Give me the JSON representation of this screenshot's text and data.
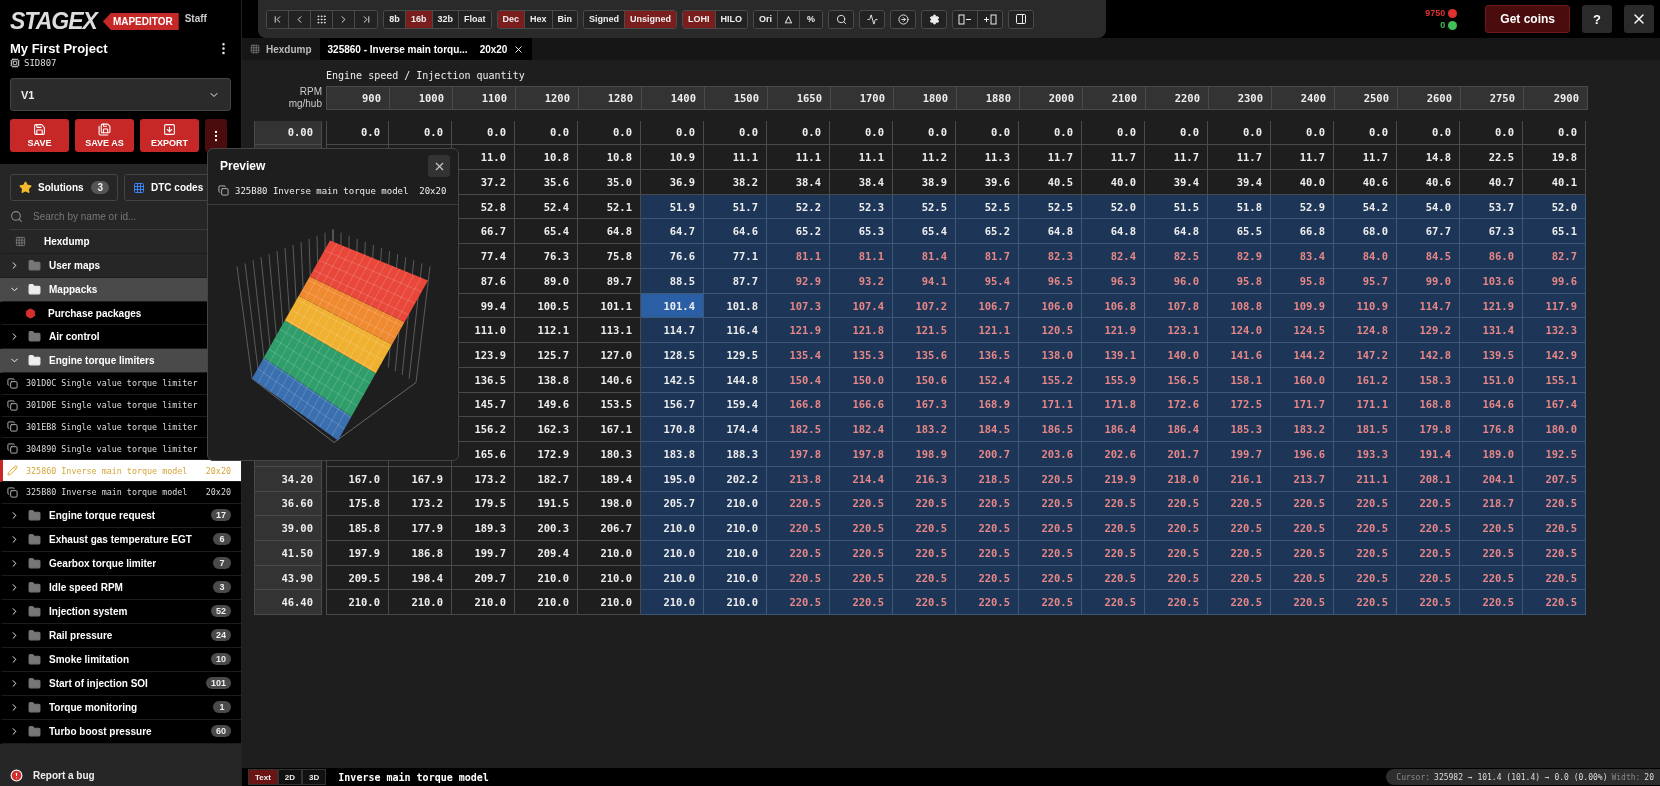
{
  "sidebar": {
    "logo": "STAGEX",
    "product": "MAPEDITOR",
    "role": "Staff",
    "project": {
      "title": "My First Project",
      "ecu": "SID807"
    },
    "version_select": {
      "value": "V1"
    },
    "actions": [
      {
        "kind": "save",
        "label": "SAVE"
      },
      {
        "kind": "save_as",
        "label": "SAVE AS"
      },
      {
        "kind": "export",
        "label": "EXPORT"
      }
    ],
    "solutions": {
      "label": "Solutions",
      "count": "3"
    },
    "dtc": {
      "label": "DTC codes"
    },
    "search": {
      "placeholder": "Search by name or id..."
    },
    "tree": [
      {
        "kind": "hexdump",
        "label": "Hexdump"
      },
      {
        "kind": "folder",
        "label": "User maps",
        "expanded": false
      },
      {
        "kind": "folder",
        "label": "Mappacks",
        "expanded": true,
        "children": [
          {
            "kind": "shop",
            "label": "Purchase packages"
          }
        ]
      },
      {
        "kind": "folder",
        "label": "Air control",
        "expanded": false
      },
      {
        "kind": "folder",
        "label": "Engine torque limiters",
        "expanded": true,
        "children": [
          {
            "kind": "map",
            "address": "301D0C",
            "label": "Single value torque limiter",
            "edited": false,
            "selected": false
          },
          {
            "kind": "map",
            "address": "301D0E",
            "label": "Single value torque limiter",
            "edited": false,
            "selected": false
          },
          {
            "kind": "map",
            "address": "301EB8",
            "label": "Single value torque limiter",
            "edited": false,
            "selected": false
          },
          {
            "kind": "map",
            "address": "304890",
            "label": "Single value torque limiter",
            "edited": false,
            "selected": false
          },
          {
            "kind": "map",
            "address": "325860",
            "label": "Inverse main torque model",
            "size": "20x20",
            "edited": true,
            "selected": true
          },
          {
            "kind": "map",
            "address": "325B80",
            "label": "Inverse main torque model",
            "size": "20x20",
            "edited": false,
            "selected": false
          }
        ]
      },
      {
        "kind": "folder",
        "label": "Engine torque request",
        "count": "17",
        "expanded": false
      },
      {
        "kind": "folder",
        "label": "Exhaust gas temperature EGT",
        "count": "6",
        "expanded": false
      },
      {
        "kind": "folder",
        "label": "Gearbox torque limiter",
        "count": "7",
        "expanded": false
      },
      {
        "kind": "folder",
        "label": "Idle speed RPM",
        "count": "3",
        "expanded": false
      },
      {
        "kind": "folder",
        "label": "Injection system",
        "count": "52",
        "expanded": false
      },
      {
        "kind": "folder",
        "label": "Rail pressure",
        "count": "24",
        "expanded": false
      },
      {
        "kind": "folder",
        "label": "Smoke limitation",
        "count": "10",
        "expanded": false
      },
      {
        "kind": "folder",
        "label": "Start of injection SOI",
        "count": "101",
        "expanded": false
      },
      {
        "kind": "folder",
        "label": "Torque monitoring",
        "count": "1",
        "expanded": false
      },
      {
        "kind": "folder",
        "label": "Turbo boost pressure",
        "count": "60",
        "expanded": false
      }
    ],
    "report": "Report a bug"
  },
  "toolbar": {
    "groups": [
      {
        "buttons": [
          {
            "label": "8b",
            "selected": false
          },
          {
            "label": "16b",
            "selected": true
          },
          {
            "label": "32b",
            "selected": false
          },
          {
            "label": "Float",
            "selected": false
          }
        ]
      },
      {
        "buttons": [
          {
            "label": "Dec",
            "selected": true
          },
          {
            "label": "Hex",
            "selected": false
          },
          {
            "label": "Bin",
            "selected": false
          }
        ]
      },
      {
        "buttons": [
          {
            "label": "Signed",
            "selected": false
          },
          {
            "label": "Unsigned",
            "selected": true
          }
        ]
      },
      {
        "buttons": [
          {
            "label": "LOHI",
            "selected": true
          },
          {
            "label": "HILO",
            "selected": false
          }
        ]
      },
      {
        "buttons": [
          {
            "label": "Ori",
            "selected": false
          },
          {
            "label": "△",
            "selected": false
          },
          {
            "label": "%",
            "selected": false
          }
        ]
      }
    ]
  },
  "account": {
    "coins": [
      {
        "value": "9750",
        "color": "#e03131"
      },
      {
        "value": "0",
        "color": "#40c057"
      }
    ],
    "get_coins": "Get coins",
    "help": "?"
  },
  "tabs": [
    {
      "kind": "hexdump",
      "label": "Hexdump",
      "selected": false
    },
    {
      "kind": "map",
      "label": "325860 - Inverse main torqu...",
      "size": "20x20",
      "selected": true
    }
  ],
  "table": {
    "title": "Engine speed / Injection quantity",
    "x_axis": "RPM",
    "y_axis": "mg/hub",
    "columns": [
      "900",
      "1000",
      "1100",
      "1200",
      "1280",
      "1400",
      "1500",
      "1650",
      "1700",
      "1800",
      "1880",
      "2000",
      "2100",
      "2200",
      "2300",
      "2400",
      "2500",
      "2600",
      "2750",
      "2900"
    ],
    "rows": [
      {
        "label": "0.00",
        "values": [
          "0.0",
          "0.0",
          "0.0",
          "0.0",
          "0.0",
          "0.0",
          "0.0",
          "0.0",
          "0.0",
          "0.0",
          "0.0",
          "0.0",
          "0.0",
          "0.0",
          "0.0",
          "0.0",
          "0.0",
          "0.0",
          "0.0",
          "0.0"
        ],
        "selected": [
          false,
          false,
          false,
          false,
          false,
          false,
          false,
          false,
          false,
          false,
          false,
          false,
          false,
          false,
          false,
          false,
          false,
          false,
          false,
          false
        ],
        "modified": [
          false,
          false,
          false,
          false,
          false,
          false,
          false,
          false,
          false,
          false,
          false,
          false,
          false,
          false,
          false,
          false,
          false,
          false,
          false,
          false
        ],
        "cursor": [
          false,
          false,
          false,
          false,
          false,
          false,
          false,
          false,
          false,
          false,
          false,
          false,
          false,
          false,
          false,
          false,
          false,
          false,
          false,
          false
        ]
      },
      {
        "values": [
          "11.0",
          "10.8",
          "10.8",
          "10.9",
          "11.1",
          "11.1",
          "11.1",
          "11.2",
          "11.3",
          "11.7",
          "11.7",
          "11.7",
          "11.7",
          "11.7",
          "11.7",
          "14.8",
          "22.5",
          "19.8"
        ],
        "selected": [
          false,
          false,
          false,
          false,
          false,
          false,
          false,
          false,
          false,
          false,
          false,
          false,
          false,
          false,
          false,
          false,
          false,
          false
        ],
        "modified": [
          false,
          false,
          false,
          false,
          false,
          false,
          false,
          false,
          false,
          false,
          false,
          false,
          false,
          false,
          false,
          false,
          false,
          false
        ],
        "cursor": [
          false,
          false,
          false,
          false,
          false,
          false,
          false,
          false,
          false,
          false,
          false,
          false,
          false,
          false,
          false,
          false,
          false,
          false
        ]
      },
      {
        "values": [
          "37.2",
          "35.6",
          "35.0",
          "36.9",
          "38.2",
          "38.4",
          "38.4",
          "38.9",
          "39.6",
          "40.5",
          "40.0",
          "39.4",
          "39.4",
          "40.0",
          "40.6",
          "40.6",
          "40.7",
          "40.1"
        ],
        "selected": [
          false,
          false,
          false,
          false,
          false,
          false,
          false,
          false,
          false,
          false,
          false,
          false,
          false,
          false,
          false,
          false,
          false,
          false
        ],
        "modified": [
          false,
          false,
          false,
          false,
          false,
          false,
          false,
          false,
          false,
          false,
          false,
          false,
          false,
          false,
          false,
          false,
          false,
          false
        ],
        "cursor": [
          false,
          false,
          false,
          false,
          false,
          false,
          false,
          false,
          false,
          false,
          false,
          false,
          false,
          false,
          false,
          false,
          false,
          false
        ]
      },
      {
        "values": [
          "52.8",
          "52.4",
          "52.1",
          "51.9",
          "51.7",
          "52.2",
          "52.3",
          "52.5",
          "52.5",
          "52.5",
          "52.0",
          "51.5",
          "51.8",
          "52.9",
          "54.2",
          "54.0",
          "53.7",
          "52.0"
        ],
        "selected": [
          false,
          false,
          false,
          true,
          true,
          true,
          true,
          true,
          true,
          true,
          true,
          true,
          true,
          true,
          true,
          true,
          true,
          true
        ],
        "modified": [
          false,
          false,
          false,
          false,
          false,
          false,
          false,
          false,
          false,
          false,
          false,
          false,
          false,
          false,
          false,
          false,
          false,
          false
        ],
        "cursor": [
          false,
          false,
          false,
          false,
          false,
          false,
          false,
          false,
          false,
          false,
          false,
          false,
          false,
          false,
          false,
          false,
          false,
          false
        ]
      },
      {
        "values": [
          "66.7",
          "65.4",
          "64.8",
          "64.7",
          "64.6",
          "65.2",
          "65.3",
          "65.4",
          "65.2",
          "64.8",
          "64.8",
          "64.8",
          "65.5",
          "66.8",
          "68.0",
          "67.7",
          "67.3",
          "65.1"
        ],
        "selected": [
          false,
          false,
          false,
          true,
          true,
          true,
          true,
          true,
          true,
          true,
          true,
          true,
          true,
          true,
          true,
          true,
          true,
          true
        ],
        "modified": [
          false,
          false,
          false,
          false,
          false,
          false,
          false,
          false,
          false,
          false,
          false,
          false,
          false,
          false,
          false,
          false,
          false,
          false
        ],
        "cursor": [
          false,
          false,
          false,
          false,
          false,
          false,
          false,
          false,
          false,
          false,
          false,
          false,
          false,
          false,
          false,
          false,
          false,
          false
        ]
      },
      {
        "values": [
          "77.4",
          "76.3",
          "75.8",
          "76.6",
          "77.1",
          "81.1",
          "81.1",
          "81.4",
          "81.7",
          "82.3",
          "82.4",
          "82.5",
          "82.9",
          "83.4",
          "84.0",
          "84.5",
          "86.0",
          "82.7"
        ],
        "selected": [
          false,
          false,
          false,
          true,
          true,
          true,
          true,
          true,
          true,
          true,
          true,
          true,
          true,
          true,
          true,
          true,
          true,
          true
        ],
        "modified": [
          false,
          false,
          false,
          false,
          false,
          true,
          true,
          true,
          true,
          true,
          true,
          true,
          true,
          true,
          true,
          true,
          true,
          true
        ],
        "cursor": [
          false,
          false,
          false,
          false,
          false,
          false,
          false,
          false,
          false,
          false,
          false,
          false,
          false,
          false,
          false,
          false,
          false,
          false
        ]
      },
      {
        "values": [
          "87.6",
          "89.0",
          "89.7",
          "88.5",
          "87.7",
          "92.9",
          "93.2",
          "94.1",
          "95.4",
          "96.5",
          "96.3",
          "96.0",
          "95.8",
          "95.8",
          "95.7",
          "99.0",
          "103.6",
          "99.6"
        ],
        "selected": [
          false,
          false,
          false,
          true,
          true,
          true,
          true,
          true,
          true,
          true,
          true,
          true,
          true,
          true,
          true,
          true,
          true,
          true
        ],
        "modified": [
          false,
          false,
          false,
          false,
          false,
          true,
          true,
          true,
          true,
          true,
          true,
          true,
          true,
          true,
          true,
          true,
          true,
          true
        ],
        "cursor": [
          false,
          false,
          false,
          false,
          false,
          false,
          false,
          false,
          false,
          false,
          false,
          false,
          false,
          false,
          false,
          false,
          false,
          false
        ]
      },
      {
        "values": [
          "99.4",
          "100.5",
          "101.1",
          "101.4",
          "101.8",
          "107.3",
          "107.4",
          "107.2",
          "106.7",
          "106.0",
          "106.8",
          "107.8",
          "108.8",
          "109.9",
          "110.9",
          "114.7",
          "121.9",
          "117.9"
        ],
        "selected": [
          false,
          false,
          false,
          true,
          true,
          true,
          true,
          true,
          true,
          true,
          true,
          true,
          true,
          true,
          true,
          true,
          true,
          true
        ],
        "modified": [
          false,
          false,
          false,
          false,
          false,
          true,
          true,
          true,
          true,
          true,
          true,
          true,
          true,
          true,
          true,
          true,
          true,
          true
        ],
        "cursor": [
          false,
          false,
          false,
          true,
          false,
          false,
          false,
          false,
          false,
          false,
          false,
          false,
          false,
          false,
          false,
          false,
          false,
          false
        ]
      },
      {
        "values": [
          "111.0",
          "112.1",
          "113.1",
          "114.7",
          "116.4",
          "121.9",
          "121.8",
          "121.5",
          "121.1",
          "120.5",
          "121.9",
          "123.1",
          "124.0",
          "124.5",
          "124.8",
          "129.2",
          "131.4",
          "132.3"
        ],
        "selected": [
          false,
          false,
          false,
          true,
          true,
          true,
          true,
          true,
          true,
          true,
          true,
          true,
          true,
          true,
          true,
          true,
          true,
          true
        ],
        "modified": [
          false,
          false,
          false,
          false,
          false,
          true,
          true,
          true,
          true,
          true,
          true,
          true,
          true,
          true,
          true,
          true,
          true,
          true
        ],
        "cursor": [
          false,
          false,
          false,
          false,
          false,
          false,
          false,
          false,
          false,
          false,
          false,
          false,
          false,
          false,
          false,
          false,
          false,
          false
        ]
      },
      {
        "values": [
          "123.9",
          "125.7",
          "127.0",
          "128.5",
          "129.5",
          "135.4",
          "135.3",
          "135.6",
          "136.5",
          "138.0",
          "139.1",
          "140.0",
          "141.6",
          "144.2",
          "147.2",
          "142.8",
          "139.5",
          "142.9"
        ],
        "selected": [
          false,
          false,
          false,
          true,
          true,
          true,
          true,
          true,
          true,
          true,
          true,
          true,
          true,
          true,
          true,
          true,
          true,
          true
        ],
        "modified": [
          false,
          false,
          false,
          false,
          false,
          true,
          true,
          true,
          true,
          true,
          true,
          true,
          true,
          true,
          true,
          true,
          true,
          true
        ],
        "cursor": [
          false,
          false,
          false,
          false,
          false,
          false,
          false,
          false,
          false,
          false,
          false,
          false,
          false,
          false,
          false,
          false,
          false,
          false
        ]
      },
      {
        "values": [
          "136.5",
          "138.8",
          "140.6",
          "142.5",
          "144.8",
          "150.4",
          "150.0",
          "150.6",
          "152.4",
          "155.2",
          "155.9",
          "156.5",
          "158.1",
          "160.0",
          "161.2",
          "158.3",
          "151.0",
          "155.1"
        ],
        "selected": [
          false,
          false,
          false,
          true,
          true,
          true,
          true,
          true,
          true,
          true,
          true,
          true,
          true,
          true,
          true,
          true,
          true,
          true
        ],
        "modified": [
          false,
          false,
          false,
          false,
          false,
          true,
          true,
          true,
          true,
          true,
          true,
          true,
          true,
          true,
          true,
          true,
          true,
          true
        ],
        "cursor": [
          false,
          false,
          false,
          false,
          false,
          false,
          false,
          false,
          false,
          false,
          false,
          false,
          false,
          false,
          false,
          false,
          false,
          false
        ]
      },
      {
        "values": [
          "145.7",
          "149.6",
          "153.5",
          "156.7",
          "159.4",
          "166.8",
          "166.6",
          "167.3",
          "168.9",
          "171.1",
          "171.8",
          "172.6",
          "172.5",
          "171.7",
          "171.1",
          "168.8",
          "164.6",
          "167.4"
        ],
        "selected": [
          false,
          false,
          false,
          true,
          true,
          true,
          true,
          true,
          true,
          true,
          true,
          true,
          true,
          true,
          true,
          true,
          true,
          true
        ],
        "modified": [
          false,
          false,
          false,
          false,
          false,
          true,
          true,
          true,
          true,
          true,
          true,
          true,
          true,
          true,
          true,
          true,
          true,
          true
        ],
        "cursor": [
          false,
          false,
          false,
          false,
          false,
          false,
          false,
          false,
          false,
          false,
          false,
          false,
          false,
          false,
          false,
          false,
          false,
          false
        ]
      },
      {
        "values": [
          "156.2",
          "162.3",
          "167.1",
          "170.8",
          "174.4",
          "182.5",
          "182.4",
          "183.2",
          "184.5",
          "186.5",
          "186.4",
          "186.4",
          "185.3",
          "183.2",
          "181.5",
          "179.8",
          "176.8",
          "180.0"
        ],
        "selected": [
          false,
          false,
          false,
          true,
          true,
          true,
          true,
          true,
          true,
          true,
          true,
          true,
          true,
          true,
          true,
          true,
          true,
          true
        ],
        "modified": [
          false,
          false,
          false,
          false,
          false,
          true,
          true,
          true,
          true,
          true,
          true,
          true,
          true,
          true,
          true,
          true,
          true,
          true
        ],
        "cursor": [
          false,
          false,
          false,
          false,
          false,
          false,
          false,
          false,
          false,
          false,
          false,
          false,
          false,
          false,
          false,
          false,
          false,
          false
        ]
      },
      {
        "values": [
          "165.6",
          "172.9",
          "180.3",
          "183.8",
          "188.3",
          "197.8",
          "197.8",
          "198.9",
          "200.7",
          "203.6",
          "202.6",
          "201.7",
          "199.7",
          "196.6",
          "193.3",
          "191.4",
          "189.0",
          "192.5"
        ],
        "selected": [
          false,
          false,
          false,
          true,
          true,
          true,
          true,
          true,
          true,
          true,
          true,
          true,
          true,
          true,
          true,
          true,
          true,
          true
        ],
        "modified": [
          false,
          false,
          false,
          false,
          false,
          true,
          true,
          true,
          true,
          true,
          true,
          true,
          true,
          true,
          true,
          true,
          true,
          true
        ],
        "cursor": [
          false,
          false,
          false,
          false,
          false,
          false,
          false,
          false,
          false,
          false,
          false,
          false,
          false,
          false,
          false,
          false,
          false,
          false
        ]
      },
      {
        "label": "34.20",
        "values": [
          "167.0",
          "167.9",
          "173.2",
          "182.7",
          "189.4",
          "195.0",
          "202.2",
          "213.8",
          "214.4",
          "216.3",
          "218.5",
          "220.5",
          "219.9",
          "218.0",
          "216.1",
          "213.7",
          "211.1",
          "208.1",
          "204.1",
          "207.5"
        ],
        "selected": [
          false,
          false,
          false,
          false,
          false,
          true,
          true,
          true,
          true,
          true,
          true,
          true,
          true,
          true,
          true,
          true,
          true,
          true,
          true,
          true
        ],
        "modified": [
          false,
          false,
          false,
          false,
          false,
          false,
          false,
          true,
          true,
          true,
          true,
          true,
          true,
          true,
          true,
          true,
          true,
          true,
          true,
          true
        ],
        "cursor": [
          false,
          false,
          false,
          false,
          false,
          false,
          false,
          false,
          false,
          false,
          false,
          false,
          false,
          false,
          false,
          false,
          false,
          false,
          false,
          false
        ]
      },
      {
        "label": "36.60",
        "values": [
          "175.8",
          "173.2",
          "179.5",
          "191.5",
          "198.0",
          "205.7",
          "210.0",
          "220.5",
          "220.5",
          "220.5",
          "220.5",
          "220.5",
          "220.5",
          "220.5",
          "220.5",
          "220.5",
          "220.5",
          "220.5",
          "218.7",
          "220.5"
        ],
        "selected": [
          false,
          false,
          false,
          false,
          false,
          true,
          true,
          true,
          true,
          true,
          true,
          true,
          true,
          true,
          true,
          true,
          true,
          true,
          true,
          true
        ],
        "modified": [
          false,
          false,
          false,
          false,
          false,
          false,
          false,
          true,
          true,
          true,
          true,
          true,
          true,
          true,
          true,
          true,
          true,
          true,
          true,
          true
        ],
        "cursor": [
          false,
          false,
          false,
          false,
          false,
          false,
          false,
          false,
          false,
          false,
          false,
          false,
          false,
          false,
          false,
          false,
          false,
          false,
          false,
          false
        ]
      },
      {
        "label": "39.00",
        "values": [
          "185.8",
          "177.9",
          "189.3",
          "200.3",
          "206.7",
          "210.0",
          "210.0",
          "220.5",
          "220.5",
          "220.5",
          "220.5",
          "220.5",
          "220.5",
          "220.5",
          "220.5",
          "220.5",
          "220.5",
          "220.5",
          "220.5",
          "220.5"
        ],
        "selected": [
          false,
          false,
          false,
          false,
          false,
          true,
          true,
          true,
          true,
          true,
          true,
          true,
          true,
          true,
          true,
          true,
          true,
          true,
          true,
          true
        ],
        "modified": [
          false,
          false,
          false,
          false,
          false,
          false,
          false,
          true,
          true,
          true,
          true,
          true,
          true,
          true,
          true,
          true,
          true,
          true,
          true,
          true
        ],
        "cursor": [
          false,
          false,
          false,
          false,
          false,
          false,
          false,
          false,
          false,
          false,
          false,
          false,
          false,
          false,
          false,
          false,
          false,
          false,
          false,
          false
        ]
      },
      {
        "label": "41.50",
        "values": [
          "197.9",
          "186.8",
          "199.7",
          "209.4",
          "210.0",
          "210.0",
          "210.0",
          "220.5",
          "220.5",
          "220.5",
          "220.5",
          "220.5",
          "220.5",
          "220.5",
          "220.5",
          "220.5",
          "220.5",
          "220.5",
          "220.5",
          "220.5"
        ],
        "selected": [
          false,
          false,
          false,
          false,
          false,
          true,
          true,
          true,
          true,
          true,
          true,
          true,
          true,
          true,
          true,
          true,
          true,
          true,
          true,
          true
        ],
        "modified": [
          false,
          false,
          false,
          false,
          false,
          false,
          false,
          true,
          true,
          true,
          true,
          true,
          true,
          true,
          true,
          true,
          true,
          true,
          true,
          true
        ],
        "cursor": [
          false,
          false,
          false,
          false,
          false,
          false,
          false,
          false,
          false,
          false,
          false,
          false,
          false,
          false,
          false,
          false,
          false,
          false,
          false,
          false
        ]
      },
      {
        "label": "43.90",
        "values": [
          "209.5",
          "198.4",
          "209.7",
          "210.0",
          "210.0",
          "210.0",
          "210.0",
          "220.5",
          "220.5",
          "220.5",
          "220.5",
          "220.5",
          "220.5",
          "220.5",
          "220.5",
          "220.5",
          "220.5",
          "220.5",
          "220.5",
          "220.5"
        ],
        "selected": [
          false,
          false,
          false,
          false,
          false,
          true,
          true,
          true,
          true,
          true,
          true,
          true,
          true,
          true,
          true,
          true,
          true,
          true,
          true,
          true
        ],
        "modified": [
          false,
          false,
          false,
          false,
          false,
          false,
          false,
          true,
          true,
          true,
          true,
          true,
          true,
          true,
          true,
          true,
          true,
          true,
          true,
          true
        ],
        "cursor": [
          false,
          false,
          false,
          false,
          false,
          false,
          false,
          false,
          false,
          false,
          false,
          false,
          false,
          false,
          false,
          false,
          false,
          false,
          false,
          false
        ]
      },
      {
        "label": "46.40",
        "values": [
          "210.0",
          "210.0",
          "210.0",
          "210.0",
          "210.0",
          "210.0",
          "210.0",
          "220.5",
          "220.5",
          "220.5",
          "220.5",
          "220.5",
          "220.5",
          "220.5",
          "220.5",
          "220.5",
          "220.5",
          "220.5",
          "220.5",
          "220.5"
        ],
        "selected": [
          false,
          false,
          false,
          false,
          false,
          true,
          true,
          true,
          true,
          true,
          true,
          true,
          true,
          true,
          true,
          true,
          true,
          true,
          true,
          true
        ],
        "modified": [
          false,
          false,
          false,
          false,
          false,
          false,
          false,
          true,
          true,
          true,
          true,
          true,
          true,
          true,
          true,
          true,
          true,
          true,
          true,
          true
        ],
        "cursor": [
          false,
          false,
          false,
          false,
          false,
          false,
          false,
          false,
          false,
          false,
          false,
          false,
          false,
          false,
          false,
          false,
          false,
          false,
          false,
          false
        ]
      }
    ]
  },
  "preview": {
    "title": "Preview",
    "map": "325B80 Inverse main torque model",
    "size": "20x20"
  },
  "bottom_bar": {
    "views": [
      {
        "label": "Text",
        "selected": true
      },
      {
        "label": "2D",
        "selected": false
      },
      {
        "label": "3D",
        "selected": false
      }
    ],
    "map_name": "Inverse main torque model",
    "status": [
      {
        "label": "Cursor:",
        "value": "325982 → 101.4 (101.4) → 0.0 (0.00%)"
      },
      {
        "label": "Width:",
        "value": "20"
      }
    ]
  }
}
